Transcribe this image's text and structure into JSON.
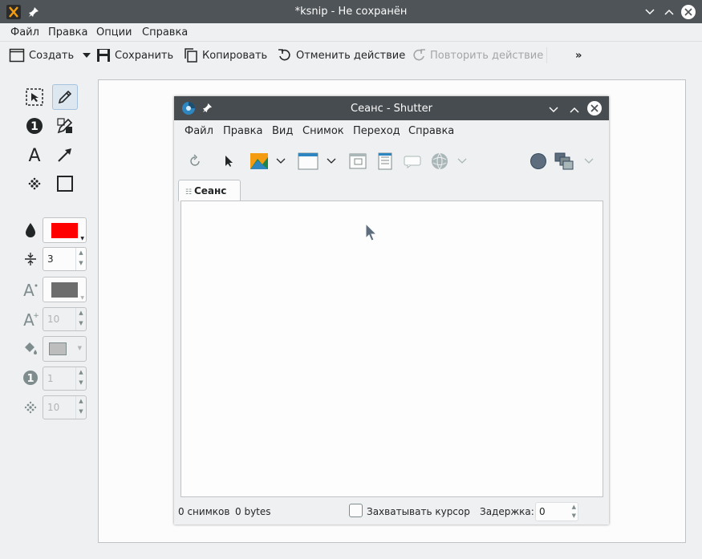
{
  "window": {
    "title": "*ksnip - Не сохранён"
  },
  "menu": [
    {
      "label": "Файл"
    },
    {
      "label": "Правка"
    },
    {
      "label": "Опции"
    },
    {
      "label": "Справка"
    }
  ],
  "toolbar": {
    "create": "Создать",
    "save": "Сохранить",
    "copy": "Копировать",
    "undo": "Отменить действие",
    "redo": "Повторить действие",
    "more": "»"
  },
  "settings": {
    "width_value": "3",
    "font_size_value": "10",
    "number_value": "1",
    "blur_value": "10",
    "pen_color": "#ff0000",
    "text_color": "#6d6d6d",
    "fill_color": "#bdbdbd"
  },
  "shutter": {
    "title": "Сеанс - Shutter",
    "menu": [
      {
        "label": "Файл"
      },
      {
        "label": "Правка"
      },
      {
        "label": "Вид"
      },
      {
        "label": "Снимок"
      },
      {
        "label": "Переход"
      },
      {
        "label": "Справка"
      }
    ],
    "tab": "Сеанс",
    "status": {
      "count": "0 снимков",
      "size": "0 bytes",
      "capture_cursor": "Захватывать курсор",
      "delay_label": "Задержка:",
      "delay_value": "0"
    }
  }
}
